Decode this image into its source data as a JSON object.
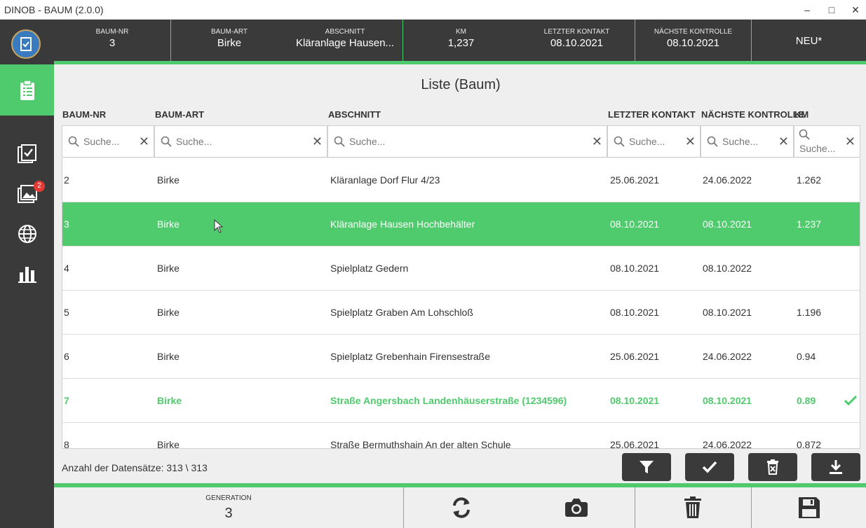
{
  "window": {
    "title": "DINOB - BAUM (2.0.0)",
    "minimize": "–",
    "maximize": "□",
    "close": "✕"
  },
  "sidebar": {
    "badge_count": "2"
  },
  "header": {
    "baum_nr_label": "BAUM-NR",
    "baum_nr": "3",
    "baum_art_label": "BAUM-ART",
    "baum_art": "Birke",
    "abschnitt_label": "ABSCHNITT",
    "abschnitt": "Kläranlage Hausen...",
    "km_label": "KM",
    "km": "1,237",
    "letzter_kontakt_label": "LETZTER KONTAKT",
    "letzter_kontakt": "08.10.2021",
    "naechste_kontrolle_label": "NÄCHSTE KONTROLLE",
    "naechste_kontrolle": "08.10.2021",
    "neu": "NEU*"
  },
  "list": {
    "title": "Liste (Baum)",
    "columns": [
      "BAUM-NR",
      "BAUM-ART",
      "ABSCHNITT",
      "LETZTER KONTAKT",
      "NÄCHSTE KONTROLLE",
      "KM"
    ],
    "search_placeholder": "Suche...",
    "rows": [
      {
        "nr": "2",
        "art": "Birke",
        "abschnitt": "Kläranlage Dorf  Flur 4/23",
        "letzter": "25.06.2021",
        "naechste": "24.06.2022",
        "km": "1.262"
      },
      {
        "nr": "3",
        "art": "Birke",
        "abschnitt": "Kläranlage Hausen  Hochbehälter",
        "letzter": "08.10.2021",
        "naechste": "08.10.2021",
        "km": "1.237"
      },
      {
        "nr": "4",
        "art": "Birke",
        "abschnitt": "Spielplatz Gedern",
        "letzter": "08.10.2021",
        "naechste": "08.10.2022",
        "km": ""
      },
      {
        "nr": "5",
        "art": "Birke",
        "abschnitt": "Spielplatz Graben  Am Lohschloß",
        "letzter": "08.10.2021",
        "naechste": "08.10.2021",
        "km": "1.196"
      },
      {
        "nr": "6",
        "art": "Birke",
        "abschnitt": "Spielplatz Grebenhain  Firensestraße",
        "letzter": "25.06.2021",
        "naechste": "24.06.2022",
        "km": "0.94"
      },
      {
        "nr": "7",
        "art": "Birke",
        "abschnitt": "Straße Angersbach  Landenhäuserstraße (1234596)",
        "letzter": "08.10.2021",
        "naechste": "08.10.2021",
        "km": "0.89"
      },
      {
        "nr": "8",
        "art": "Birke",
        "abschnitt": "Straße Bermuthshain  An der alten Schule",
        "letzter": "25.06.2021",
        "naechste": "24.06.2022",
        "km": "0.872"
      }
    ],
    "count_text": "Anzahl der Datensätze: 313 \\ 313"
  },
  "footer": {
    "generation_label": "GENERATION",
    "generation": "3"
  },
  "colors": {
    "accent": "#4fca6c",
    "dark": "#3a3a3a"
  }
}
